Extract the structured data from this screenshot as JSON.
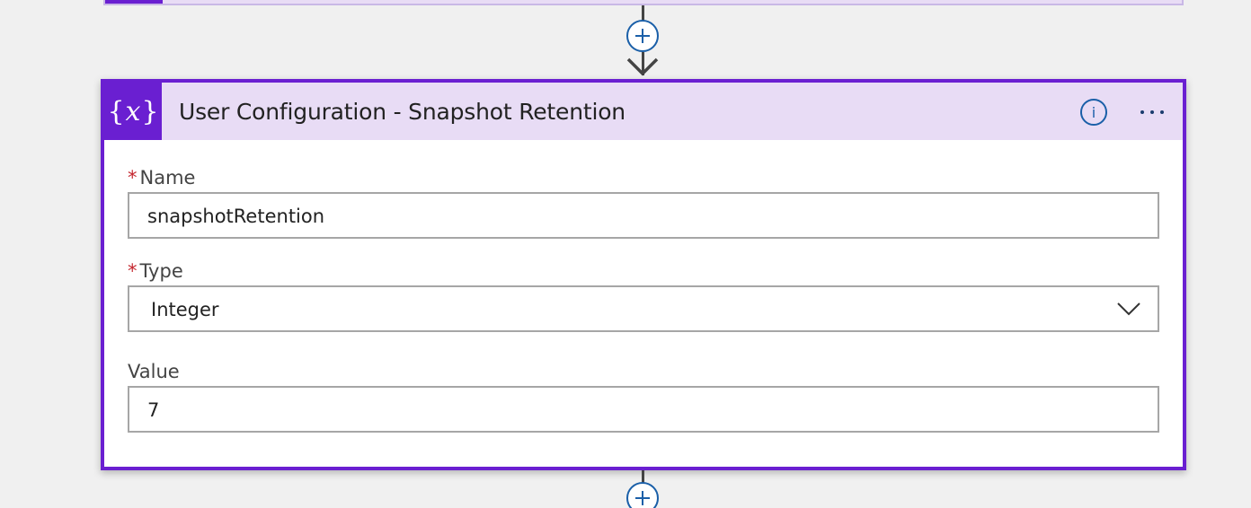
{
  "card": {
    "title": "User Configuration - Snapshot Retention",
    "icon": "variable-icon",
    "icon_glyph_open": "{",
    "icon_glyph_var": "x",
    "icon_glyph_close": "}",
    "info_icon_glyph": "i",
    "more_icon": "ellipsis-icon"
  },
  "fields": {
    "name": {
      "required_mark": "*",
      "label": "Name",
      "value": "snapshotRetention"
    },
    "type": {
      "required_mark": "*",
      "label": "Type",
      "value": "Integer"
    },
    "value": {
      "label": "Value",
      "value": "7"
    }
  },
  "colors": {
    "accent": "#6a1fd1",
    "header_bg": "#e8dcf5",
    "link_blue": "#1a5fa8",
    "required_red": "#c4262e",
    "canvas_bg": "#f0f0f0"
  }
}
